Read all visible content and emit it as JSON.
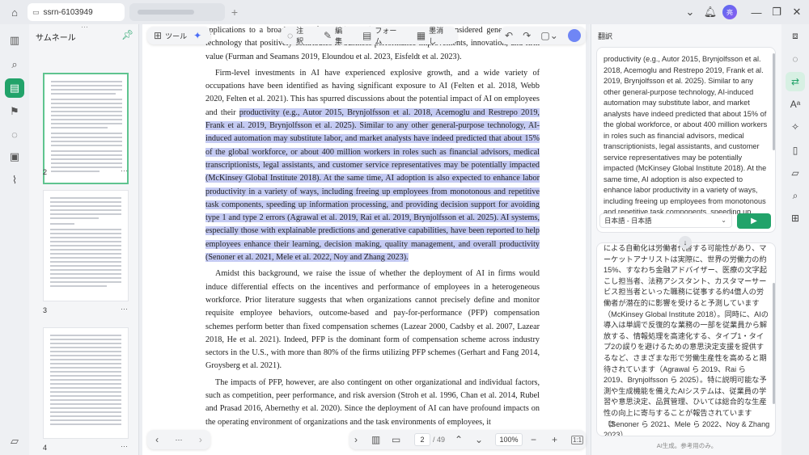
{
  "titlebar": {
    "tab_label": "ssrn-6103949",
    "avatar_text": "亮",
    "add_tab": "+"
  },
  "thumbnails": {
    "title": "サムネール",
    "pages": [
      {
        "num": "2",
        "more": "···"
      },
      {
        "num": "3",
        "more": "···"
      },
      {
        "num": "4",
        "more": "···"
      }
    ]
  },
  "toolbar": {
    "tool_label": "ツール",
    "comment_label": "注釈",
    "edit_label": "編集",
    "form_label": "フォーム",
    "redact_label": "墨消し"
  },
  "document": {
    "p0_lines": "applications to a broad range of tasks (e.g., ...), ...ingly, such AI is considered general-purpose technology that positively contributes to business performance improvements, innovation, and firm value (Furman and Seamans 2019, Eloundou et al. 2023, Eisfeldt et al. 2023).",
    "p1_pre": "Firm-level investments in AI have experienced explosive growth, and a wide variety of occupations have been identified as having significant exposure to AI (Felten et al. 2018, Webb 2020, Felten et al. 2021). This has spurred discussions about the potential impact of AI on employees and their ",
    "p1_hl": "productivity (e.g., Autor 2015, Brynjolfsson et al. 2018, Acemoglu and Restrepo 2019, Frank et al. 2019, Brynjolfsson et al. 2025). Similar to any other general-purpose technology, AI-induced automation may substitute labor, and market analysts have indeed predicted that about 15% of the global workforce, or about 400 million workers in roles such as financial advisors, medical transcriptionists, legal assistants, and customer service representatives may be potentially impacted (McKinsey Global Institute 2018). At the same time, AI adoption is also expected to enhance labor productivity in a variety of ways, including freeing up employees from monotonous and repetitive task components, speeding up information processing, and providing decision support for avoiding type 1 and type 2 errors (Agrawal et al. 2019, Rai et al. 2019, Brynjolfsson et al. 2025). AI systems, especially those with explainable predictions and generative capabilities, have been reported to help employees enhance their learning, decision making, quality management, and overall productivity (Senoner et al. 2021, Mele et al. 2022, Noy and Zhang 2023).",
    "p2": "Amidst this background, we raise the issue of whether the deployment of AI in firms would induce differential effects on the incentives and performance of employees in a heterogeneous workforce. Prior literature suggests that when organizations cannot precisely define and monitor requisite employee behaviors, outcome-based and pay-for-performance (PFP) compensation schemes perform better than fixed compensation schemes (Lazear 2000, Cadsby et al. 2007, Lazear 2018, He et al. 2021). Indeed, PFP is the dominant form of compensation scheme across industry sectors in the U.S., with more than 80% of the firms utilizing PFP schemes (Gerhart and Fang 2014, Groysberg et al. 2021).",
    "p3": "The impacts of PFP, however, are also contingent on other organizational and individual factors, such as competition, peer performance, and risk aversion (Stroh et al. 1996, Chan et al. 2014, Rubel and Prasad 2016, Abernethy et al. 2020). Since the deployment of AI can have profound impacts on the operating environment of organizations and the task environments of employees, it"
  },
  "bottombar": {
    "more": "···",
    "page_current": "2",
    "page_total": "/ 49",
    "zoom": "100%"
  },
  "translate": {
    "title": "翻訳",
    "source_text": "productivity (e.g., Autor 2015, Brynjolfsson et al. 2018, Acemoglu and Restrepo 2019, Frank et al. 2019, Brynjolfsson et al. 2025). Similar to any other general-purpose technology, AI-induced automation may substitute labor, and market analysts have indeed predicted that about 15% of the global workforce, or about 400 million workers in roles such as financial advisors, medical transcriptionists, legal assistants, and customer service representatives may be potentially impacted (McKinsey Global Institute 2018). At the same time, AI adoption is also expected to enhance labor productivity in a variety of ways, including freeing up employees from monotonous and repetitive task components, speeding up",
    "language": "日本語 - 日本語",
    "output_text": "による自動化は労働者代替する可能性があり、マーケットアナリストは実際に、世界の労働力の約15%、すなわち金融アドバイザー、医療の文字起こし担当者、法務アシスタント、カスタマーサービス担当者といった職務に従事する約4億人の労働者が潜在的に影響を受けると予測しています（McKinsey Global Institute 2018）。同時に、AIの導入は単調で反復的な業務の一部を従業員から解放する、情報処理を高速化する、タイプ1・タイプ2の誤りを避けるための意思決定支援を提供するなど、さまざまな形で労働生産性を高めると期待されています（Agrawal ら 2019、Rai ら 2019、Brynjolfsson ら 2025）。特に説明可能な予測や生成機能を備えたAIシステムは、従業員の学習や意思決定、品質管理、ひいては総合的な生産性の向上に寄与することが報告されています（Senoner ら 2021、Mele ら 2022、Noy & Zhang 2023）。",
    "disclaimer": "AI生成。参考用のみ。"
  }
}
